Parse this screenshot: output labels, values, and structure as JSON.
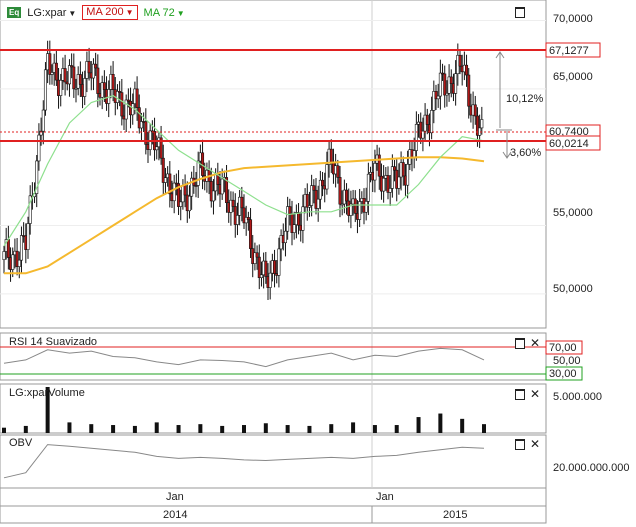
{
  "price_panel": {
    "eq_label": "Eq",
    "symbol": "LG:xpar",
    "ma200_label": "MA 200",
    "ma72_label": "MA 72",
    "ma200_color": "#f5b92e",
    "ma72_color": "#8ee08e",
    "level_line_color": "#e02020",
    "y_ticks": [
      "70,0000",
      "65,0000",
      "55,0000",
      "50,0000"
    ],
    "level_high": "67,1277",
    "level_low": "60,0214",
    "last_price": "60,7400",
    "pct_up": "10,12%",
    "pct_down": "3,60%"
  },
  "rsi_panel": {
    "title": "RSI 14 Suavizado",
    "upper": "70,00",
    "lower": "30,00",
    "mid_tick": "50,00",
    "upper_color": "#e02020",
    "lower_color": "#20a020"
  },
  "volume_panel": {
    "title": "LG:xparVolume",
    "tick": "5.000.000"
  },
  "obv_panel": {
    "title": "OBV",
    "tick": "20.000.000.000"
  },
  "time_axis": {
    "month_1": "Jan",
    "month_2": "Jan",
    "year_1": "2014",
    "year_2": "2015"
  },
  "chart_data": {
    "type": "candlestick",
    "x": [
      "2013-06",
      "2013-07",
      "2013-08",
      "2013-09",
      "2013-10",
      "2013-11",
      "2013-12",
      "2014-01",
      "2014-02",
      "2014-03",
      "2014-04",
      "2014-05",
      "2014-06",
      "2014-07",
      "2014-08",
      "2014-09",
      "2014-10",
      "2014-11",
      "2014-12",
      "2015-01",
      "2015-02",
      "2015-03",
      "2015-04"
    ],
    "close": [
      52.5,
      53.5,
      66.5,
      65.5,
      66.0,
      64.5,
      63.5,
      60.5,
      56.5,
      59.0,
      57.5,
      55.5,
      50.5,
      55.0,
      56.5,
      59.5,
      55.5,
      59.0,
      58.0,
      61.5,
      65.0,
      66.5,
      60.7
    ],
    "ma200": [
      51.5,
      51.5,
      52.0,
      53.0,
      54.0,
      55.0,
      56.0,
      57.0,
      57.8,
      58.4,
      58.9,
      59.2,
      59.3,
      59.4,
      59.5,
      59.6,
      59.7,
      59.8,
      59.9,
      60.0,
      60.0,
      59.9,
      59.7
    ],
    "ma72": [
      53.5,
      56.0,
      59.5,
      62.5,
      64.0,
      64.5,
      63.5,
      62.0,
      60.5,
      59.5,
      58.5,
      57.5,
      56.5,
      55.8,
      56.0,
      56.0,
      56.5,
      56.5,
      56.5,
      58.0,
      60.0,
      61.5,
      61.2
    ],
    "rsi": [
      40,
      45,
      60,
      55,
      58,
      50,
      48,
      42,
      38,
      45,
      44,
      42,
      35,
      45,
      50,
      55,
      45,
      52,
      50,
      58,
      62,
      60,
      45
    ],
    "volume": [
      0.6,
      0.8,
      5.2,
      1.2,
      1.0,
      0.9,
      0.8,
      1.2,
      0.9,
      1.0,
      0.8,
      0.9,
      1.1,
      0.9,
      0.8,
      1.0,
      1.2,
      0.9,
      0.9,
      1.8,
      2.2,
      1.6,
      1.0
    ],
    "obv": [
      0.2,
      0.3,
      0.85,
      0.82,
      0.78,
      0.74,
      0.7,
      0.62,
      0.58,
      0.6,
      0.58,
      0.55,
      0.54,
      0.56,
      0.58,
      0.6,
      0.58,
      0.62,
      0.64,
      0.7,
      0.75,
      0.8,
      0.78
    ],
    "ylim": [
      47.5,
      71.5
    ],
    "rsi_ylim": [
      15,
      85
    ],
    "grid": true,
    "legend": "top-left"
  }
}
